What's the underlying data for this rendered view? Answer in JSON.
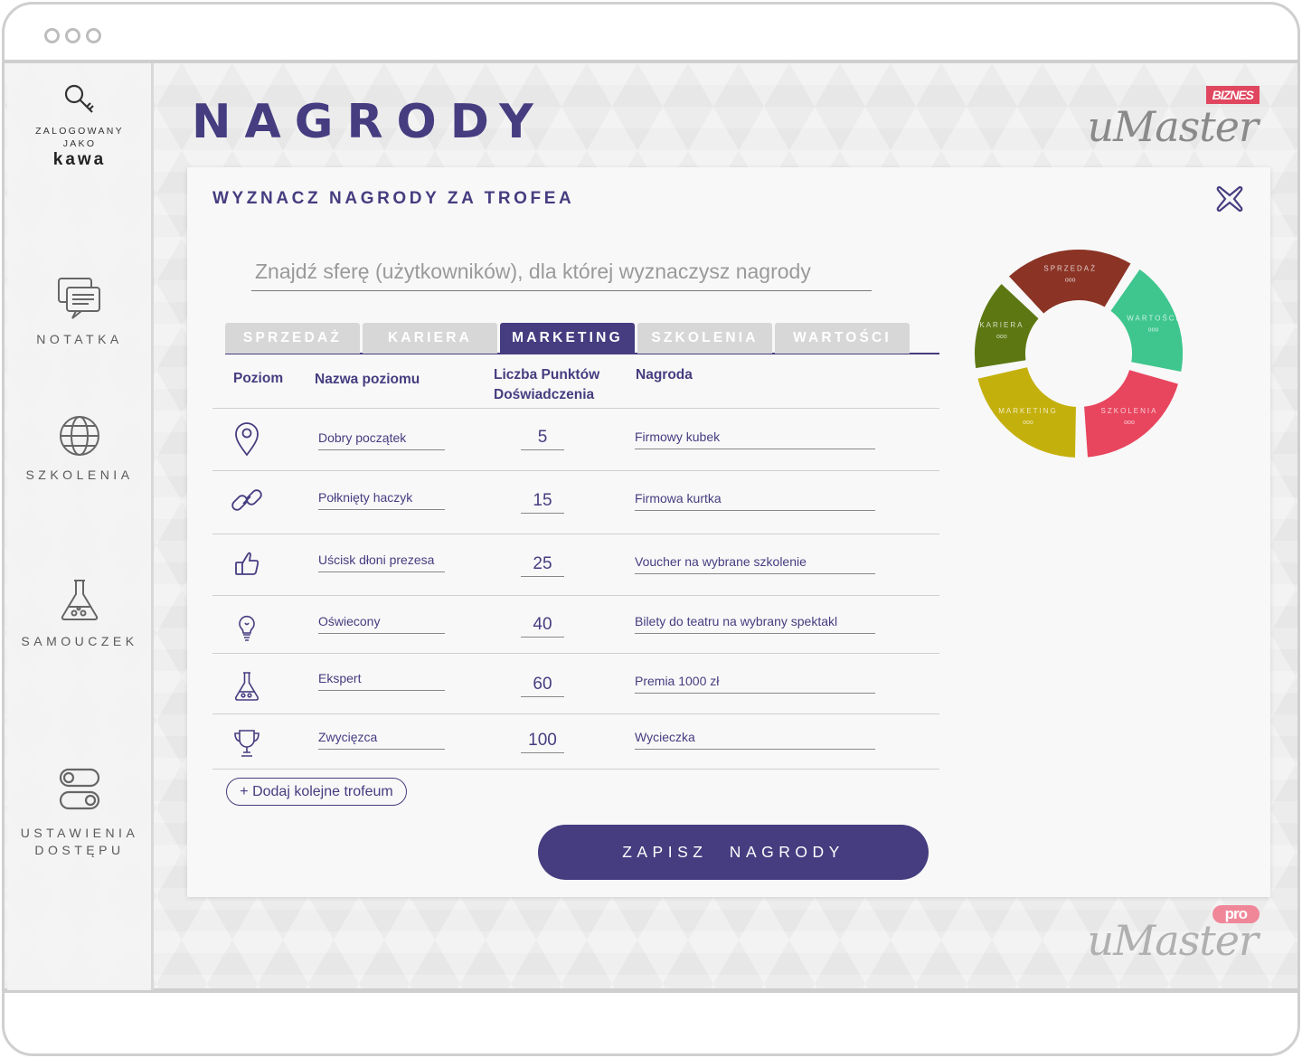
{
  "window": {
    "controls": [
      "dot",
      "dot",
      "dot"
    ]
  },
  "sidebar": {
    "logged_as_line1": "ZALOGOWANY",
    "logged_as_line2": "JAKO",
    "username": "kawa",
    "items": [
      {
        "label": "NOTATKA",
        "icon": "chat-icon"
      },
      {
        "label": "SZKOLENIA",
        "icon": "globe-icon"
      },
      {
        "label": "SAMOUCZEK",
        "icon": "flask-icon"
      },
      {
        "label_line1": "USTAWIENIA",
        "label_line2": "DOSTĘPU",
        "icon": "toggles-icon"
      }
    ]
  },
  "page": {
    "title": "NAGRODY"
  },
  "brand": {
    "name": "uMaster",
    "badge_top": "BIZNES",
    "badge_bottom": "pro"
  },
  "panel": {
    "title": "WYZNACZ NAGRODY ZA TROFEA",
    "search_placeholder": "Znajdź sferę (użytkowników), dla której wyznaczysz nagrody",
    "tabs": [
      "SPRZEDAŻ",
      "KARIERA",
      "MARKETING",
      "SZKOLENIA",
      "WARTOŚCI"
    ],
    "active_tab": "MARKETING",
    "columns": {
      "level": "Poziom",
      "level_name": "Nazwa poziomu",
      "points_line1": "Liczba Punktów",
      "points_line2": "Doświadczenia",
      "reward": "Nagroda"
    },
    "rows": [
      {
        "icon": "map-pin-icon",
        "name": "Dobry początek",
        "points": "5",
        "reward": "Firmowy kubek"
      },
      {
        "icon": "link-icon",
        "name": "Połknięty haczyk",
        "points": "15",
        "reward": "Firmowa kurtka"
      },
      {
        "icon": "thumbs-up-icon",
        "name": "Uścisk dłoni prezesa",
        "points": "25",
        "reward": "Voucher na wybrane szkolenie"
      },
      {
        "icon": "lightbulb-icon",
        "name": "Oświecony",
        "points": "40",
        "reward": "Bilety do teatru na wybrany spektakl"
      },
      {
        "icon": "flask-icon",
        "name": "Ekspert",
        "points": "60",
        "reward": "Premia 1000 zł"
      },
      {
        "icon": "trophy-icon",
        "name": "Zwycięzca",
        "points": "100",
        "reward": "Wycieczka"
      }
    ],
    "add_button": "+ Dodaj kolejne trofeum",
    "save_button": "ZAPISZ NAGRODY"
  },
  "donut": {
    "segments": [
      {
        "label": "SPRZEDAŻ",
        "sub": "ooo",
        "color": "#8b3426"
      },
      {
        "label": "WARTOŚCI",
        "sub": "ooo",
        "color": "#3ec68e"
      },
      {
        "label": "SZKOLENIA",
        "sub": "ooo",
        "color": "#e8455e"
      },
      {
        "label": "MARKETING",
        "sub": "ooo",
        "color": "#c4b00c"
      },
      {
        "label": "KARIERA",
        "sub": "ooo",
        "color": "#5d7813"
      }
    ]
  },
  "colors": {
    "accent": "#453d80",
    "tab_inactive": "#d7d7d7",
    "badge": "#e0465f"
  }
}
